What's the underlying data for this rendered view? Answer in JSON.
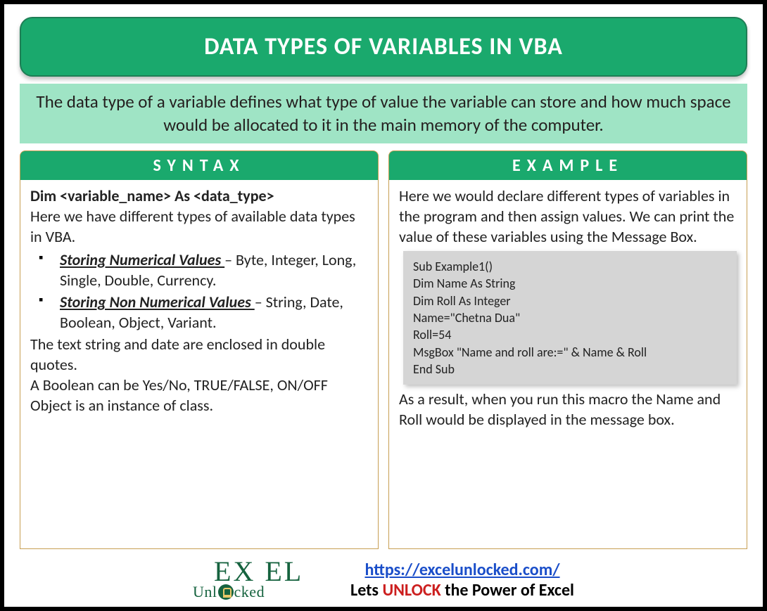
{
  "header": {
    "title": "DATA TYPES OF VARIABLES IN VBA"
  },
  "description": "The data type of a variable defines what type of value the variable can store and how much space would be allocated to it in the main memory of the computer.",
  "syntax": {
    "header": "SYNTAX",
    "code_line": "Dim <variable_name> As <data_type>",
    "intro": "Here we have different types of available data types in VBA.",
    "bullets": [
      {
        "head": "Storing Numerical Values ",
        "tail": "– Byte, Integer, Long, Single, Double, Currency."
      },
      {
        "head": "Storing Non Numerical Values ",
        "tail": "– String, Date, Boolean, Object, Variant."
      }
    ],
    "note1": "The text string and date are enclosed in double quotes.",
    "note2": "A Boolean can be Yes/No, TRUE/FALSE, ON/OFF",
    "note3": "Object is an instance of class."
  },
  "example": {
    "header": "EXAMPLE",
    "intro": "Here we would declare different types of variables in the program and then assign values. We can print the value of these variables using the Message Box.",
    "code": [
      "Sub Example1()",
      "Dim Name As String",
      "Dim Roll As Integer",
      "Name=\"Chetna Dua\"",
      "Roll=54",
      "MsgBox \"Name and roll are:=\" & Name & Roll",
      "End Sub"
    ],
    "outro": "As a result, when you run this macro the Name and Roll would be displayed in the message box."
  },
  "footer": {
    "logo_top": "EX   EL",
    "logo_bot_pre": "Unl",
    "logo_bot_post": "cked",
    "url": "https://excelunlocked.com/",
    "tagline_pre": "Lets ",
    "tagline_unlock": "UNLOCK",
    "tagline_post": " the Power of Excel"
  }
}
